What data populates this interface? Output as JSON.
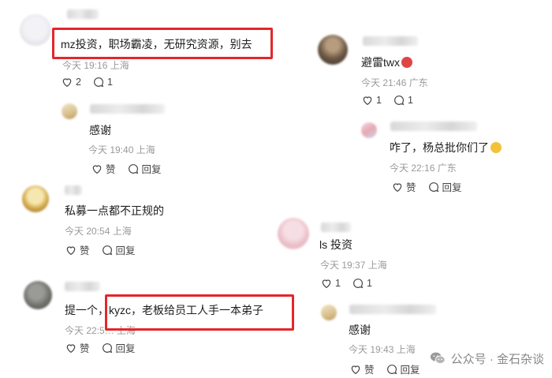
{
  "comments": [
    {
      "text": "mz投资，职场霸凌，无研究资源，别去",
      "time": "今天 19:16 上海",
      "likes": "2",
      "replies": "1"
    },
    {
      "text": "感谢",
      "time": "今天 19:40 上海",
      "like_label": "赞",
      "reply_label": "回复"
    },
    {
      "text": "私募一点都不正规的",
      "time": "今天 20:54 上海",
      "like_label": "赞",
      "reply_label": "回复"
    },
    {
      "text": "提一个，kyzc，老板给员工人手一本弟子",
      "time": "今天 22:5…  上海",
      "like_label": "赞",
      "reply_label": "回复"
    },
    {
      "text": "避雷twx",
      "time": "今天 21:46 广东",
      "likes": "1",
      "replies": "1"
    },
    {
      "text": "咋了，杨总批你们了",
      "time": "今天 22:16 广东",
      "like_label": "赞",
      "reply_label": "回复"
    },
    {
      "text": "ls 投资",
      "time": "今天 19:37 上海",
      "likes": "1",
      "replies": "1"
    },
    {
      "text": "感谢",
      "time": "今天 19:43 上海",
      "like_label": "赞",
      "reply_label": "回复"
    }
  ],
  "watermark": {
    "text": "公众号 · 金石杂谈"
  },
  "colors": {
    "highlight": "#e4262b",
    "muted": "#9a9a9a"
  }
}
